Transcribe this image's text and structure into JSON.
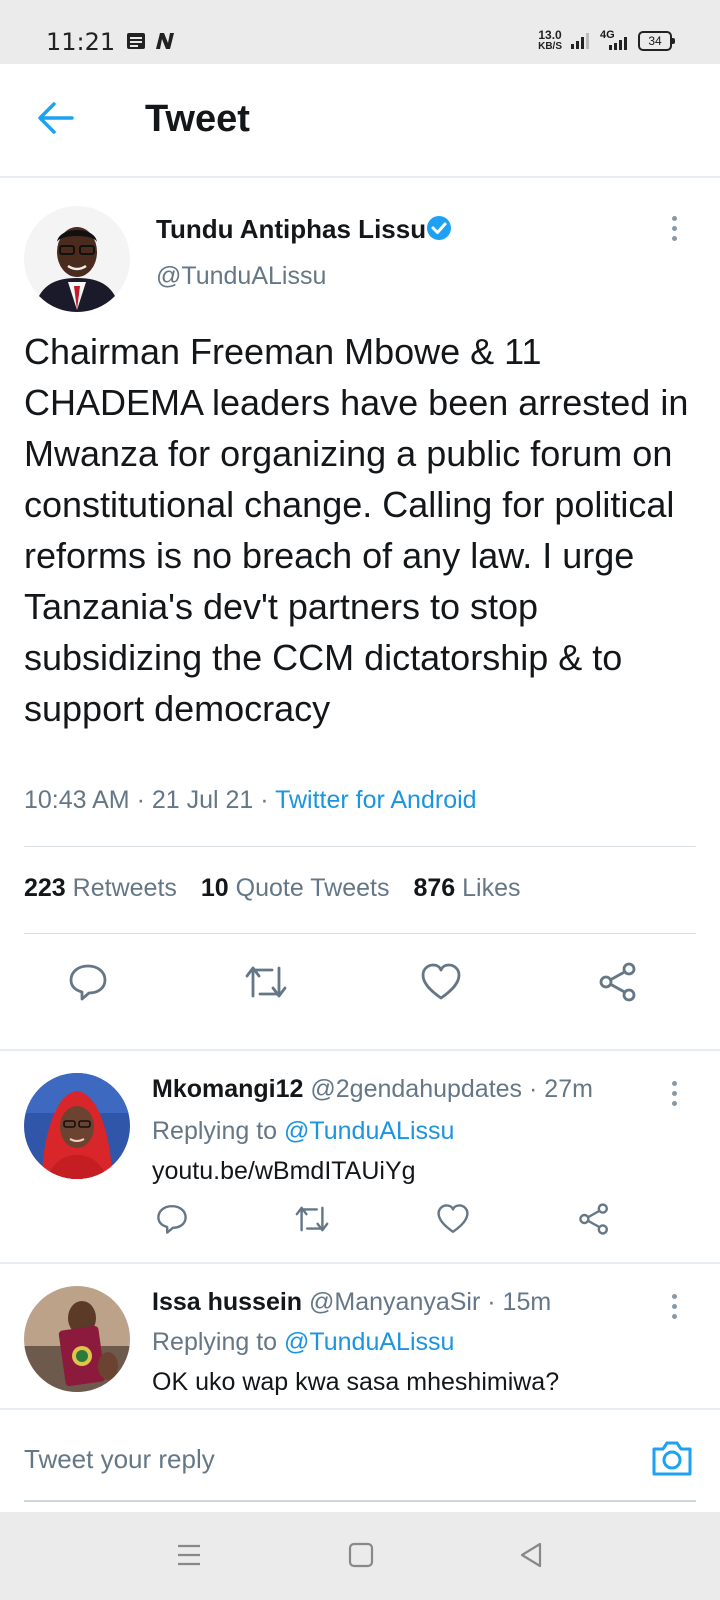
{
  "status_bar": {
    "time": "11:21",
    "net_speed_value": "13.0",
    "net_speed_unit": "KB/S",
    "network": "4G",
    "battery": "34"
  },
  "header": {
    "title": "Tweet"
  },
  "tweet": {
    "author_name": "Tundu Antiphas Lissu",
    "author_handle": "@TunduALissu",
    "text": "Chairman Freeman Mbowe & 11 CHADEMA leaders have been arrested in Mwanza for organizing a public forum on constitutional change. Calling for political reforms is no breach of any law. I urge Tanzania's dev't partners to stop subsidizing the CCM dictatorship & to support democracy",
    "time": "10:43 AM · 21 Jul 21 · ",
    "source": "Twitter for Android",
    "retweets_count": "223",
    "retweets_label": "Retweets",
    "quotes_count": "10",
    "quotes_label": "Quote Tweets",
    "likes_count": "876",
    "likes_label": "Likes"
  },
  "replies": [
    {
      "name": "Mkomangi12",
      "handle": "@2gendahupdates",
      "time": "· 27m",
      "replying_label": "Replying to",
      "replying_to": "@TunduALissu",
      "body": "youtu.be/wBmdITAUiYg"
    },
    {
      "name": "Issa hussein",
      "handle": "@ManyanyaSir",
      "time": "· 15m",
      "replying_label": "Replying to",
      "replying_to": "@TunduALissu",
      "body": "OK uko wap kwa sasa mheshimiwa?"
    }
  ],
  "compose": {
    "placeholder": "Tweet your reply"
  },
  "colors": {
    "accent": "#1da1f2",
    "link": "#1b95e0",
    "muted": "#657786"
  }
}
